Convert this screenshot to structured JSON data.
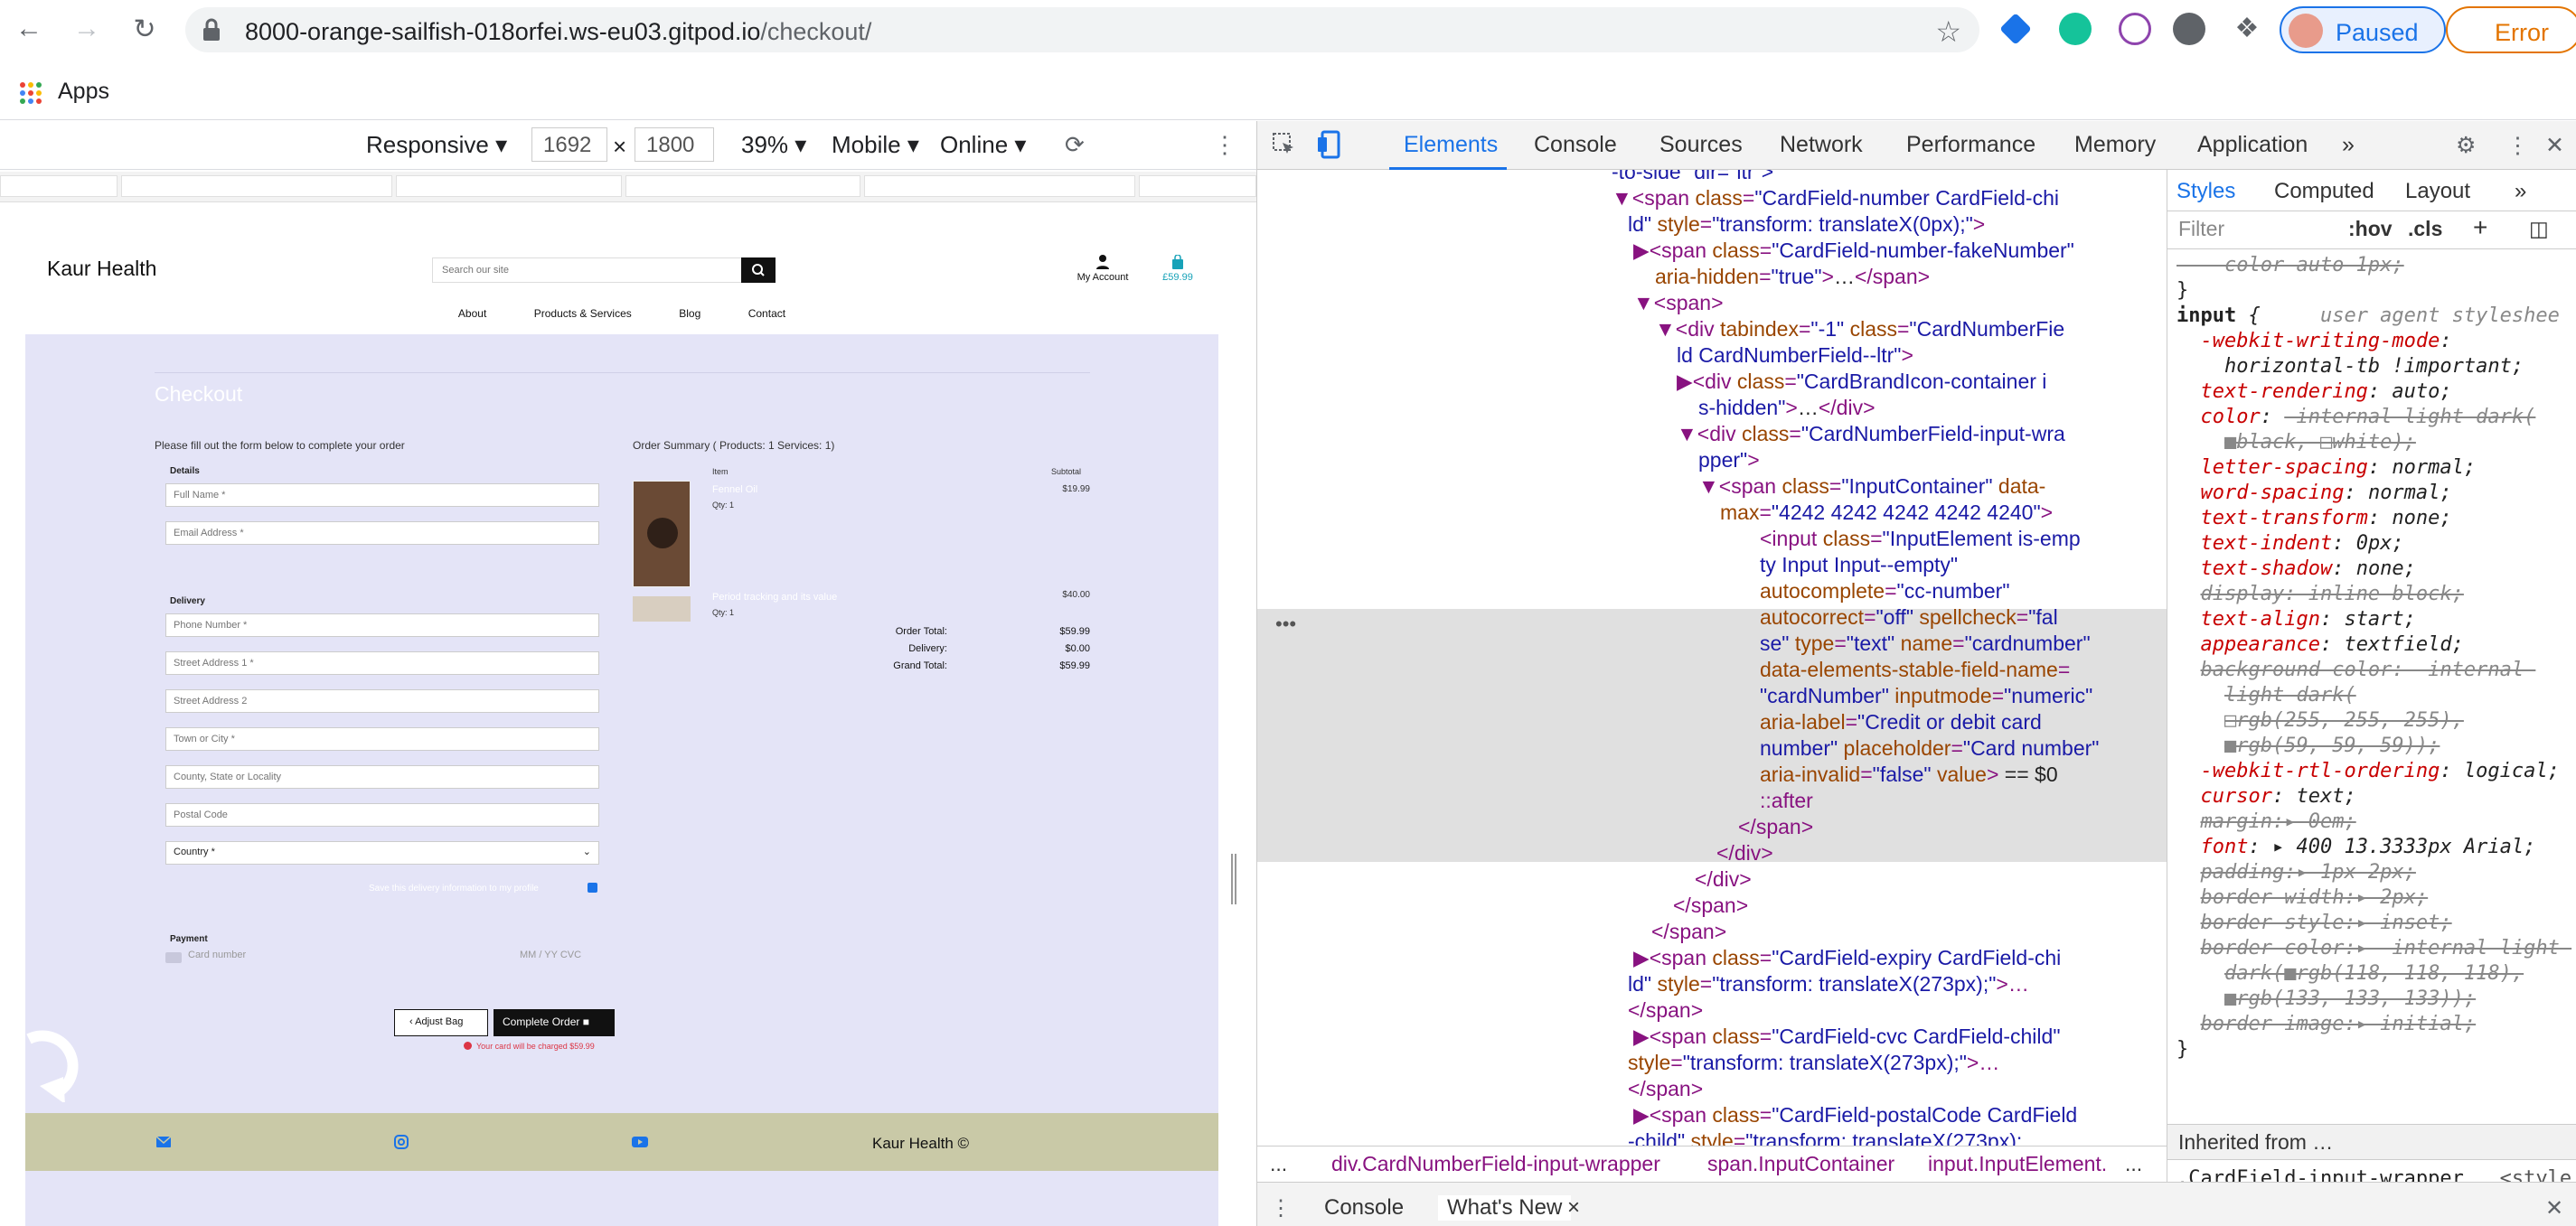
{
  "browser": {
    "url_host": "8000-orange-sailfish-018orfei.ws-eu03.gitpod.io",
    "url_path": "/checkout/",
    "profile_status": "Paused",
    "error_label": "Error",
    "bookmarks": {
      "apps_label": "Apps"
    }
  },
  "device_toolbar": {
    "mode": "Responsive",
    "width": "1692",
    "times": "×",
    "height": "1800",
    "zoom": "39%",
    "device_type": "Mobile",
    "throttle": "Online"
  },
  "site": {
    "brand": "Kaur Health",
    "search_placeholder": "Search our site",
    "account_label": "My Account",
    "bag_total": "£59.99",
    "nav": [
      "About",
      "Products & Services",
      "Blog",
      "Contact"
    ],
    "checkout_title": "Checkout",
    "intro": "Please fill out the form below to complete your order",
    "details_label": "Details",
    "delivery_label": "Delivery",
    "payment_label": "Payment",
    "fields": {
      "full_name": "Full Name *",
      "email": "Email Address *",
      "phone": "Phone Number *",
      "street1": "Street Address 1 *",
      "street2": "Street Address 2",
      "town": "Town or City *",
      "county": "County, State or Locality",
      "postal": "Postal Code",
      "country": "Country *"
    },
    "save_info": "Save this delivery information to my profile",
    "card_placeholder": "Card number",
    "card_expiry": "MM / YY  CVC",
    "summary": {
      "title": "Order Summary ( Products: 1 Services: 1)",
      "head_item": "Item",
      "head_subtotal": "Subtotal",
      "lines": [
        {
          "name": "Fennel Oil",
          "qty": "Qty: 1",
          "price": "$19.99"
        },
        {
          "name": "Period tracking and its value",
          "qty": "Qty: 1",
          "price": "$40.00"
        }
      ],
      "totals": [
        {
          "label": "Order Total:",
          "value": "$59.99"
        },
        {
          "label": "Delivery:",
          "value": "$0.00"
        },
        {
          "label": "Grand Total:",
          "value": "$59.99"
        }
      ]
    },
    "adjust_bag": "Adjust Bag",
    "complete_order": "Complete Order",
    "charge_warning": "Your card will be charged $59.99",
    "footer_brand": "Kaur Health ©"
  },
  "devtools": {
    "tabs": [
      "Elements",
      "Console",
      "Sources",
      "Network",
      "Performance",
      "Memory",
      "Application"
    ],
    "more_tabs": "»",
    "styles_tabs": [
      "Styles",
      "Computed",
      "Layout"
    ],
    "styles_more": "»",
    "filter_placeholder": "Filter",
    "hov": ":hov",
    "cls": ".cls",
    "plus": "+",
    "inherited_from": "Inherited from …",
    "breadcrumbs": [
      "div.CardNumberField-input-wrapper",
      "span.InputContainer",
      "input.InputElement."
    ],
    "crumb_more": "...",
    "drawer_tabs": [
      "Console",
      "What's New"
    ],
    "drawer_close": "×",
    "selected_dots": "•••"
  }
}
